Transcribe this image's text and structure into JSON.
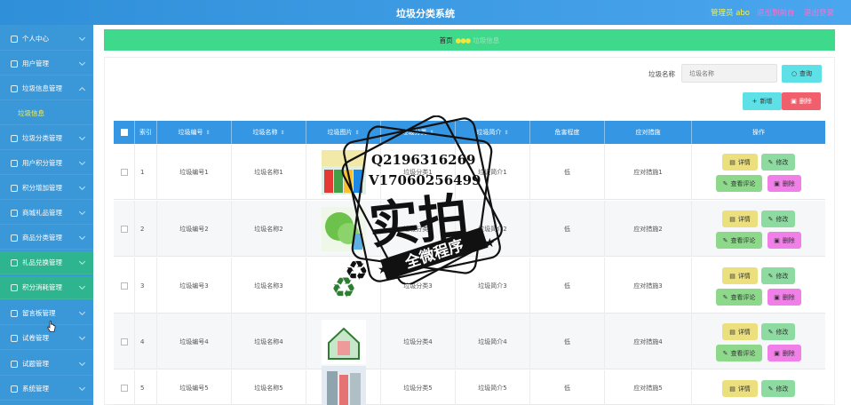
{
  "header": {
    "title": "垃圾分类系统",
    "admin": "管理员 abo",
    "back_link": "退出到前台",
    "logout_link": "退出登录"
  },
  "sidebar": {
    "items": [
      {
        "label": "个人中心"
      },
      {
        "label": "用户管理"
      },
      {
        "label": "垃圾信息管理"
      },
      {
        "label": "垃圾信息"
      },
      {
        "label": "垃圾分类管理"
      },
      {
        "label": "用户积分管理"
      },
      {
        "label": "积分增加管理"
      },
      {
        "label": "商城礼品管理"
      },
      {
        "label": "商品分类管理"
      },
      {
        "label": "礼品兑换管理"
      },
      {
        "label": "积分消耗管理"
      },
      {
        "label": "留言板管理"
      },
      {
        "label": "试卷管理"
      },
      {
        "label": "试题管理"
      },
      {
        "label": "系统管理"
      }
    ]
  },
  "breadcrumb": {
    "home": "首页",
    "current": "垃圾信息"
  },
  "search": {
    "label": "垃圾名称",
    "placeholder": "垃圾名称",
    "button": "查询"
  },
  "toolbar": {
    "add": "新增",
    "delete": "删除"
  },
  "table": {
    "headers": [
      "索引",
      "垃圾编号",
      "垃圾名称",
      "垃圾图片",
      "垃圾分类",
      "垃圾简介",
      "危害程度",
      "应对措施",
      "操作"
    ],
    "rows": [
      {
        "index": "1",
        "code": "垃圾编号1",
        "name": "垃圾名称1",
        "category": "垃圾分类1",
        "intro": "垃圾简介1",
        "level": "低",
        "measure": "应对措施1"
      },
      {
        "index": "2",
        "code": "垃圾编号2",
        "name": "垃圾名称2",
        "category": "垃圾分类2",
        "intro": "垃圾简介2",
        "level": "低",
        "measure": "应对措施2"
      },
      {
        "index": "3",
        "code": "垃圾编号3",
        "name": "垃圾名称3",
        "category": "垃圾分类3",
        "intro": "垃圾简介3",
        "level": "低",
        "measure": "应对措施3"
      },
      {
        "index": "4",
        "code": "垃圾编号4",
        "name": "垃圾名称4",
        "category": "垃圾分类4",
        "intro": "垃圾简介4",
        "level": "低",
        "measure": "应对措施4"
      },
      {
        "index": "5",
        "code": "垃圾编号5",
        "name": "垃圾名称5",
        "category": "垃圾分类5",
        "intro": "垃圾简介5",
        "level": "低",
        "measure": "应对措施5"
      }
    ],
    "actions": {
      "detail": "详情",
      "edit": "修改",
      "review": "查看评论",
      "delete": "删除"
    }
  },
  "watermark": {
    "qq": "Q2196316269",
    "vx": "V17060256499",
    "big": "实拍",
    "banner": "全微程序"
  },
  "colors": {
    "header": "#2f8fd8",
    "sidebar": "#3a97d8",
    "breadcrumb": "#3ed98b",
    "table_head": "#3596e4"
  }
}
